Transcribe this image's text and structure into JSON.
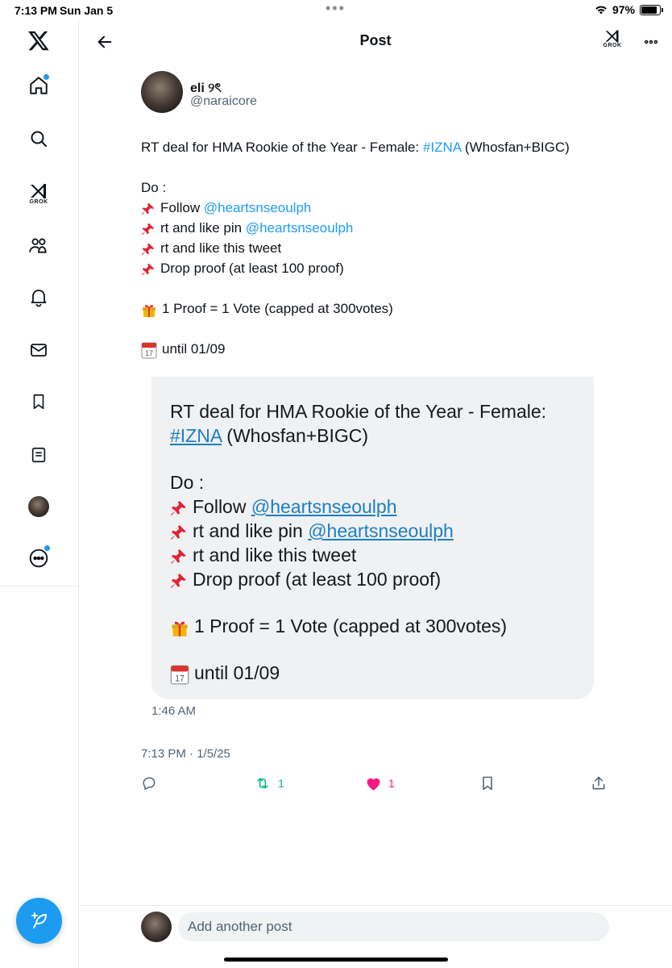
{
  "status_bar": {
    "time": "7:13 PM",
    "date": "Sun Jan 5",
    "battery": "97%",
    "battery_level": 0.97
  },
  "sidebar": {
    "grok_label": "GROK",
    "items": [
      {
        "name": "x-logo",
        "icon": "x-logo-icon"
      },
      {
        "name": "home",
        "icon": "home-icon",
        "notification_dot": true
      },
      {
        "name": "explore",
        "icon": "search-icon"
      },
      {
        "name": "grok",
        "icon": "grok-icon"
      },
      {
        "name": "communities",
        "icon": "communities-icon"
      },
      {
        "name": "notifications",
        "icon": "bell-icon"
      },
      {
        "name": "messages",
        "icon": "envelope-icon"
      },
      {
        "name": "bookmarks",
        "icon": "bookmark-icon"
      },
      {
        "name": "lists",
        "icon": "list-icon"
      },
      {
        "name": "profile",
        "icon": "avatar"
      },
      {
        "name": "more",
        "icon": "more-circle-icon",
        "notification_dot": true
      }
    ]
  },
  "header": {
    "title": "Post",
    "grok_label": "GROK"
  },
  "post": {
    "author_name": "eli ୨ৎ",
    "author_handle": "@naraicore",
    "line1_text": "RT deal for HMA Rookie of the Year - Female: ",
    "line1_hashtag": "#IZNA",
    "line1_tail": " (Whosfan+BIGC)",
    "do": "Do :",
    "follow_text": "Follow ",
    "follow_mention": "@heartsnseoulph",
    "rt_pin_text": "rt and like pin ",
    "rt_pin_mention": "@heartsnseoulph",
    "rt_tweet_text": "rt and like this tweet",
    "drop_text": "Drop proof (at least 100 proof)",
    "proof_text": "1 Proof = 1 Vote (capped at 300votes)",
    "until_text": "until 01/09",
    "meta": "7:13 PM · 1/5/25"
  },
  "embed": {
    "line1": "RT deal for HMA Rookie of the Year - Female:",
    "line2_hashtag": "#IZNA",
    "line2_tail": " (Whosfan+BIGC)",
    "do": "Do :",
    "follow_text": "Follow ",
    "follow_mention": "@heartsnseoulph",
    "rt_pin_text": "rt and like pin ",
    "rt_pin_mention": "@heartsnseoulph",
    "rt_tweet_text": "rt and like this tweet",
    "drop_text": "Drop proof (at least 100 proof)",
    "proof_text": "1 Proof = 1 Vote (capped at 300votes)",
    "until_text": "until 01/09",
    "calendar_day": "17",
    "time": "1:46 AM"
  },
  "actions": {
    "reply_count": "",
    "retweet_count": "1",
    "like_count": "1",
    "retweet_color": "#00ba7c",
    "like_color": "#f91880"
  },
  "reply": {
    "placeholder": "Add another post"
  },
  "colors": {
    "accent": "#1d9bf0",
    "text": "#0f1419",
    "muted": "#536471"
  }
}
